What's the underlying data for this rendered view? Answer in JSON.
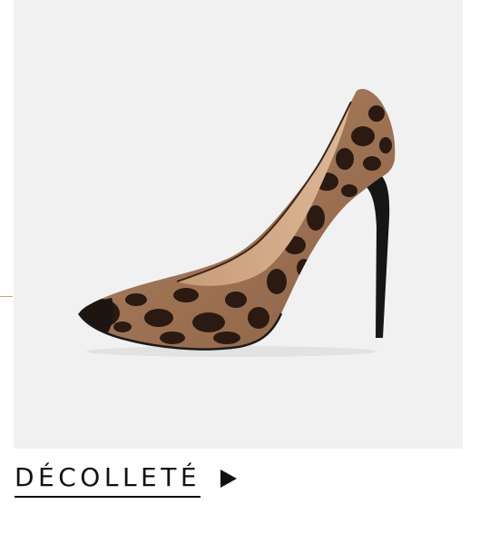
{
  "product": {
    "image_description_icon": "leopard-print-pump-shoe"
  },
  "cta": {
    "label": "DÉCOLLETÉ",
    "arrow_icon": "play-arrow-icon"
  },
  "colors": {
    "card_background": "#f1f1f1",
    "text": "#111111",
    "accent_rule": "#c9a58a"
  }
}
